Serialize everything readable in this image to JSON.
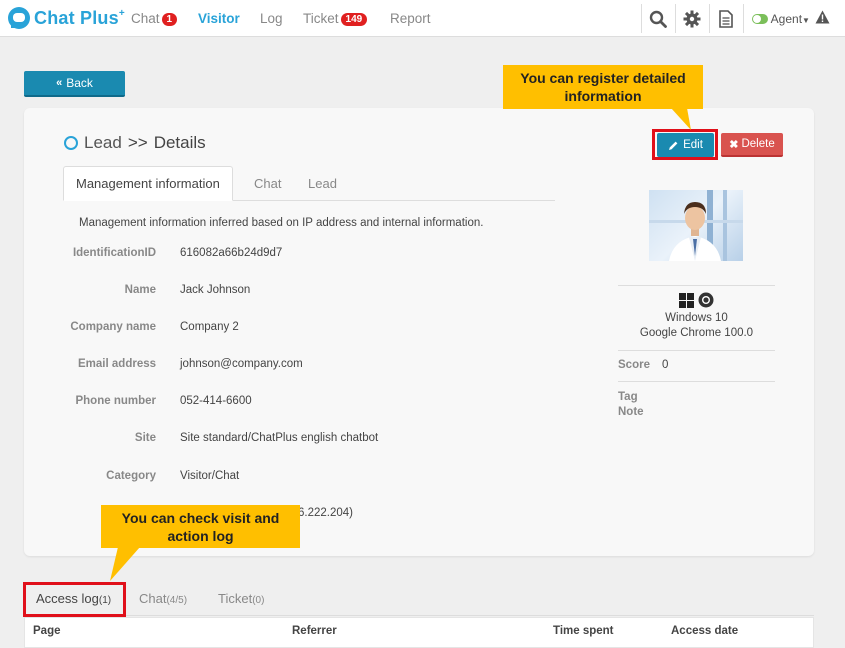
{
  "app": {
    "name": "Chat Plus",
    "plus": "+"
  },
  "nav": {
    "chat": {
      "label": "Chat",
      "badge": "1"
    },
    "visitor": {
      "label": "Visitor"
    },
    "log": {
      "label": "Log"
    },
    "ticket": {
      "label": "Ticket",
      "badge": "149"
    },
    "report": {
      "label": "Report"
    },
    "agent": {
      "label": "Agent"
    }
  },
  "back_label": "Back",
  "page": {
    "title": "Lead",
    "title_sep": ">>",
    "title_sub": "Details",
    "tabs": [
      "Management information",
      "Chat",
      "Lead"
    ],
    "info_note": "Management information inferred based on IP address and internal information.",
    "fields": [
      {
        "label": "IdentificationID",
        "value": "616082a66b24d9d7"
      },
      {
        "label": "Name",
        "value": "Jack Johnson"
      },
      {
        "label": "Company name",
        "value": "Company 2"
      },
      {
        "label": "Email address",
        "value": "johnson@company.com"
      },
      {
        "label": "Phone number",
        "value": "052-414-6600"
      },
      {
        "label": "Site",
        "value": "Site standard/ChatPlus english chatbot"
      },
      {
        "label": "Category",
        "value": "Visitor/Chat"
      },
      {
        "label": "",
        "value": "6.222.204)"
      }
    ],
    "edit_label": "Edit",
    "delete_label": "Delete"
  },
  "side": {
    "os": "Windows 10",
    "browser": "Google Chrome 100.0",
    "score_label": "Score",
    "score_value": "0",
    "tag_label": "Tag",
    "note_label": "Note"
  },
  "callouts": {
    "edit": "You can register detailed information",
    "log": "You can check visit and action log"
  },
  "bottom_tabs": [
    {
      "label": "Access log",
      "count": "(1)"
    },
    {
      "label": "Chat",
      "count": "(4/5)"
    },
    {
      "label": "Ticket",
      "count": "(0)"
    }
  ],
  "table_headers": [
    "Page",
    "Referrer",
    "Time spent",
    "Access date"
  ],
  "colors": {
    "accent": "#29a3d8",
    "primary_button": "#1a8ab0",
    "danger": "#d9534f",
    "callout": "#ffbf00",
    "highlight": "#e0101a"
  }
}
